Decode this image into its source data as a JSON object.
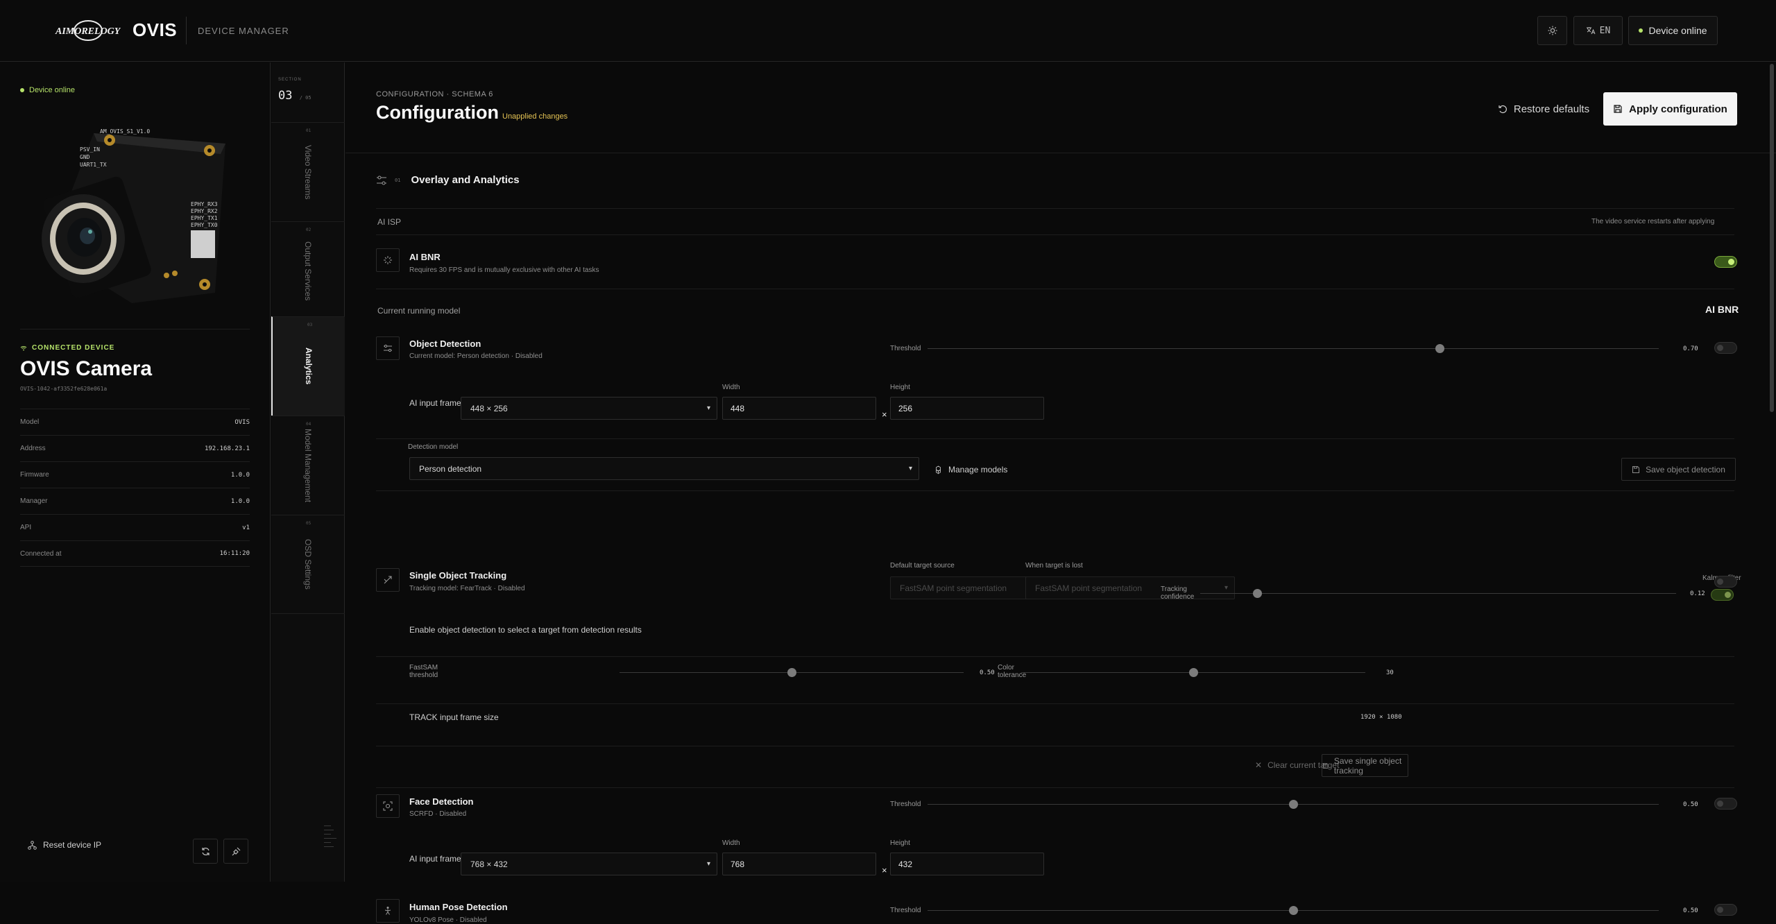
{
  "topbar": {
    "logo_text": "AIMORELOGY",
    "brand": "OVIS",
    "subtitle": "DEVICE MANAGER",
    "lang": "EN",
    "status": "Device online"
  },
  "device": {
    "online_label": "Device online",
    "connected_label": "CONNECTED DEVICE",
    "name": "OVIS Camera",
    "id": "OVIS-1042-af3352fe628e061a",
    "props": [
      {
        "k": "Model",
        "v": "OVIS"
      },
      {
        "k": "Address",
        "v": "192.168.23.1"
      },
      {
        "k": "Firmware",
        "v": "1.0.0"
      },
      {
        "k": "Manager",
        "v": "1.0.0"
      },
      {
        "k": "API",
        "v": "v1"
      },
      {
        "k": "Connected at",
        "v": "16:11:20"
      }
    ],
    "reset_label": "Reset device IP"
  },
  "nav": {
    "section_label": "SECTION",
    "section_num": "03",
    "section_total": "/ 05",
    "tabs": [
      {
        "num": "01",
        "label": "Video Streams"
      },
      {
        "num": "02",
        "label": "Output Services"
      },
      {
        "num": "03",
        "label": "Analytics"
      },
      {
        "num": "04",
        "label": "Model Management"
      },
      {
        "num": "05",
        "label": "OSD Settings"
      }
    ]
  },
  "main": {
    "crumb": "CONFIGURATION · SCHEMA 6",
    "title": "Configuration",
    "unapplied": "Unapplied changes",
    "restore": "Restore defaults",
    "apply": "Apply configuration",
    "section_no": "01",
    "section_title": "Overlay and Analytics",
    "ai_isp": "AI ISP",
    "restart_note": "The video service restarts after applying",
    "ai_bnr": {
      "title": "AI BNR",
      "sub": "Requires 30 FPS and is mutually exclusive with other AI tasks",
      "enabled": true
    },
    "running_label": "Current running model",
    "running_value": "AI BNR",
    "object_detection": {
      "title": "Object Detection",
      "sub": "Current model: Person detection · Disabled",
      "threshold_label": "Threshold",
      "threshold": 0.7,
      "threshold_text": "0.70",
      "frame_label": "AI input frame size",
      "frame_select": "448 × 256",
      "width_label": "Width",
      "width": "448",
      "height_label": "Height",
      "height": "256",
      "model_label": "Detection model",
      "model": "Person detection",
      "manage": "Manage models",
      "save": "Save object detection"
    },
    "sot": {
      "title": "Single Object Tracking",
      "sub": "Tracking model: FearTrack · Disabled",
      "target_src_label": "Default target source",
      "target_src": "FastSAM point segmentation",
      "lost_label": "When target is lost",
      "lost": "FastSAM point segmentation",
      "conf_label": "Tracking confidence",
      "conf": 0.12,
      "conf_text": "0.12",
      "kalman_label": "Kalman filter",
      "hint": "Enable object detection to select a target from detection results",
      "fastsam_label": "FastSAM threshold",
      "fastsam": 0.5,
      "fastsam_text": "0.50",
      "color_label": "Color tolerance",
      "color": 30,
      "color_text": "30",
      "track_label": "TRACK input frame size",
      "track_w": "1920",
      "track_h": "1080",
      "clear": "Clear current target",
      "save": "Save single object tracking"
    },
    "face": {
      "title": "Face Detection",
      "sub": "SCRFD · Disabled",
      "threshold_label": "Threshold",
      "threshold": 0.5,
      "threshold_text": "0.50",
      "frame_label": "AI input frame size",
      "frame_select": "768 × 432",
      "width_label": "Width",
      "width": "768",
      "height_label": "Height",
      "height": "432"
    },
    "pose": {
      "title": "Human Pose Detection",
      "sub": "YOLOv8 Pose · Disabled",
      "threshold_label": "Threshold",
      "threshold": 0.5,
      "threshold_text": "0.50"
    }
  },
  "colors": {
    "accent": "#b6e36a",
    "warning": "#e4c354"
  }
}
